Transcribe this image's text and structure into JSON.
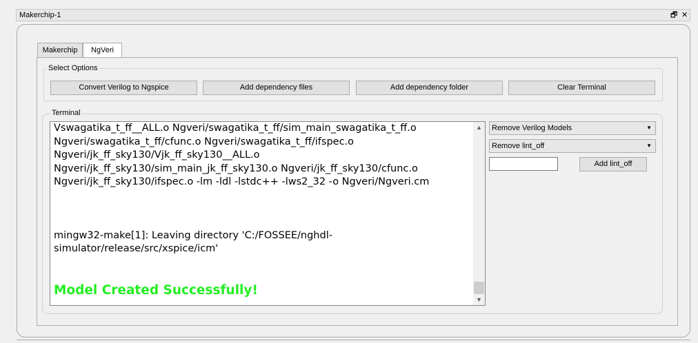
{
  "window": {
    "title": "Makerchip-1",
    "restore_glyph": "🗗",
    "close_glyph": "✕"
  },
  "tabs": [
    {
      "label": "Makerchip",
      "active": false
    },
    {
      "label": "NgVeri",
      "active": true
    }
  ],
  "select_options": {
    "title": "Select Options",
    "buttons": {
      "convert": "Convert Verilog to Ngspice",
      "add_files": "Add dependency files",
      "add_folder": "Add dependency folder",
      "clear": "Clear Terminal"
    }
  },
  "terminal": {
    "title": "Terminal",
    "line1": "Vswagatika_t_ff__ALL.o Ngveri/swagatika_t_ff/sim_main_swagatika_t_ff.o Ngveri/swagatika_t_ff/cfunc.o Ngveri/swagatika_t_ff/ifspec.o Ngveri/jk_ff_sky130/Vjk_ff_sky130__ALL.o Ngveri/jk_ff_sky130/sim_main_jk_ff_sky130.o Ngveri/jk_ff_sky130/cfunc.o Ngveri/jk_ff_sky130/ifspec.o -lm -ldl -lstdc++ -lws2_32 -o Ngveri/Ngveri.cm",
    "line2": "mingw32-make[1]: Leaving directory 'C:/FOSSEE/nghdl-simulator/release/src/xspice/icm'",
    "success": "Model Created Successfully!",
    "success_color": "#22ee22"
  },
  "side_panel": {
    "remove_models": "Remove Verilog Models",
    "remove_lint": "Remove lint_off",
    "lint_input_value": "",
    "add_lint": "Add lint_off"
  }
}
